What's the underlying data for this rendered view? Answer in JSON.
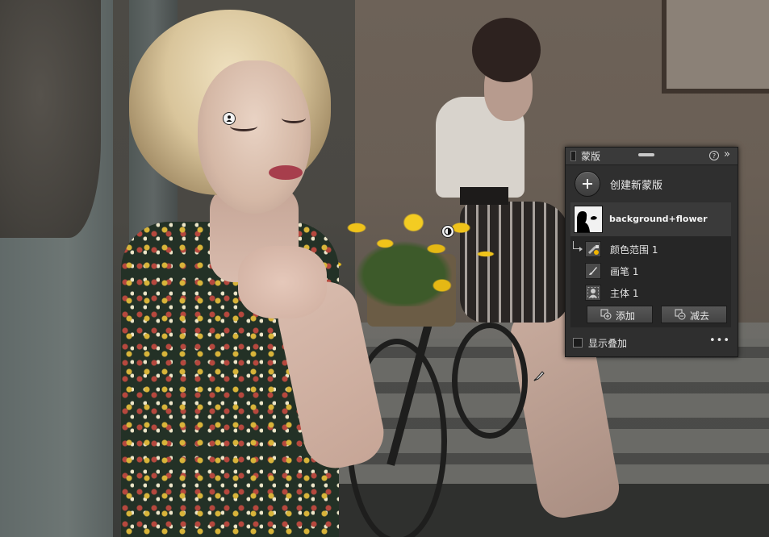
{
  "panel": {
    "title": "蒙版",
    "help_icon": "help-circle-icon",
    "collapse_icon": "double-chevron-right-icon",
    "create_label": "创建新蒙版",
    "mask": {
      "name": "background+flower",
      "components": [
        {
          "label": "颜色范围 1",
          "icon": "color-range-icon"
        },
        {
          "label": "画笔 1",
          "icon": "brush-icon"
        },
        {
          "label": "主体 1",
          "icon": "subject-icon"
        }
      ]
    },
    "add_label": "添加",
    "subtract_label": "减去",
    "show_overlay_label": "显示叠加",
    "show_overlay_checked": false,
    "more_label": "•••"
  },
  "colors": {
    "panel_bg": "#2f2f2f",
    "panel_header": "#3a3a3a",
    "selected_row": "#3a3a3a",
    "text": "#e6e6e6"
  }
}
